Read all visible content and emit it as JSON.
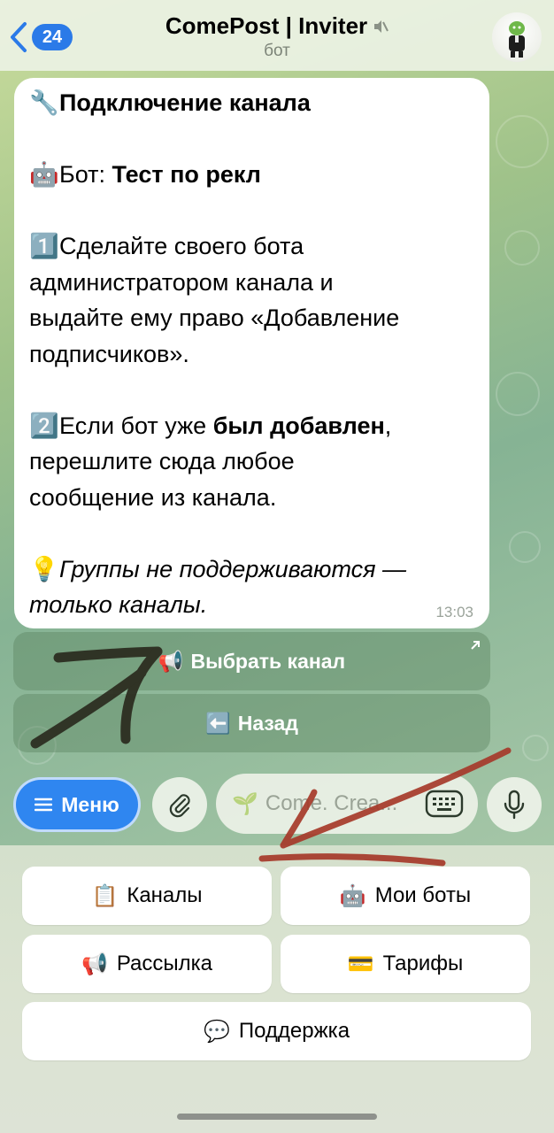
{
  "header": {
    "back_count": "24",
    "title": "ComePost | Inviter",
    "subtitle": "бот"
  },
  "message": {
    "heading_emoji": "🔧",
    "heading": "Подключение канала",
    "bot_emoji": "🤖",
    "bot_label": "Бот: ",
    "bot_name": "Тест по рекл",
    "step1_emoji": "1️⃣",
    "step1_line1": "Сделайте своего бота",
    "step1_line2": "администратором канала и",
    "step1_line3": "выдайте ему право «Добавление",
    "step1_line4": "подписчиков».",
    "step2_emoji": "2️⃣",
    "step2_prefix": "Если бот уже ",
    "step2_bold": "был добавлен",
    "step2_suffix": ",",
    "step2_line2": "перешлите сюда любое",
    "step2_line3": "сообщение из канала.",
    "note_emoji": "💡",
    "note_line1": "Группы не поддерживаются —",
    "note_line2": "только каналы.",
    "time": "13:03"
  },
  "inline_buttons": [
    {
      "emoji": "📢",
      "label": "Выбрать канал"
    },
    {
      "emoji": "⬅️",
      "label": "Назад"
    }
  ],
  "composer": {
    "menu_label": "Меню",
    "input_emoji": "🌱",
    "input_text": "Come. Crea..."
  },
  "keyboard": [
    {
      "emoji": "📋",
      "label": "Каналы"
    },
    {
      "emoji": "🤖",
      "label": "Мои боты"
    },
    {
      "emoji": "📢",
      "label": "Рассылка"
    },
    {
      "emoji": "💳",
      "label": "Тарифы"
    },
    {
      "emoji": "💬",
      "label": "Поддержка"
    }
  ],
  "colors": {
    "accent": "#2f86f0",
    "annotation_dark": "#2a2a1e",
    "annotation_red": "#a63a2a"
  }
}
